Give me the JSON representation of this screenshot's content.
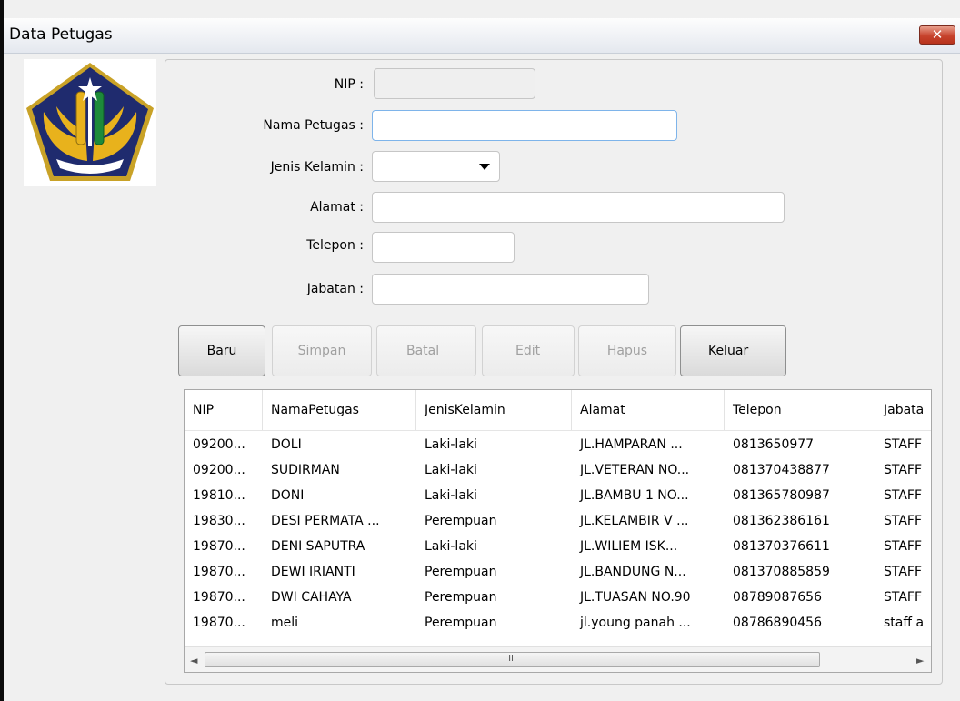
{
  "window": {
    "title": "Data Petugas",
    "close_glyph": "✕"
  },
  "form": {
    "nip_label": "NIP :",
    "nama_label": "Nama Petugas :",
    "jenis_label": "Jenis Kelamin :",
    "alamat_label": "Alamat :",
    "telepon_label": "Telepon :",
    "jabatan_label": "Jabatan :",
    "nip_value": "",
    "nama_value": "",
    "jenis_value": "",
    "alamat_value": "",
    "telepon_value": "",
    "jabatan_value": ""
  },
  "buttons": {
    "baru": "Baru",
    "simpan": "Simpan",
    "batal": "Batal",
    "edit": "Edit",
    "hapus": "Hapus",
    "keluar": "Keluar"
  },
  "table": {
    "columns": [
      "NIP",
      "NamaPetugas",
      "JenisKelamin",
      "Alamat",
      "Telepon",
      "Jabata"
    ],
    "rows": [
      [
        "09200...",
        "DOLI",
        "Laki-laki",
        "JL.HAMPARAN ...",
        "0813650977",
        "STAFF"
      ],
      [
        "09200...",
        "SUDIRMAN",
        "Laki-laki",
        "JL.VETERAN NO...",
        "081370438877",
        "STAFF"
      ],
      [
        "19810...",
        "DONI",
        "Laki-laki",
        "JL.BAMBU 1 NO...",
        "081365780987",
        "STAFF"
      ],
      [
        "19830...",
        "DESI PERMATA ...",
        "Perempuan",
        "JL.KELAMBIR V ...",
        "081362386161",
        "STAFF"
      ],
      [
        "19870...",
        "DENI SAPUTRA",
        "Laki-laki",
        "JL.WILIEM ISK...",
        "081370376611",
        "STAFF"
      ],
      [
        "19870...",
        "DEWI IRIANTI",
        "Perempuan",
        "JL.BANDUNG N...",
        "081370885859",
        "STAFF"
      ],
      [
        "19870...",
        "DWI CAHAYA",
        "Perempuan",
        "JL.TUASAN NO.90",
        "08789087656",
        "STAFF"
      ],
      [
        "19870...",
        "meli",
        "Perempuan",
        "jl.young panah ...",
        "08786890456",
        "staff a"
      ]
    ],
    "scroll_left_glyph": "◄",
    "scroll_right_glyph": "►",
    "scroll_grip_glyph": "III"
  },
  "colors": {
    "emblem_blue": "#1f2b6e",
    "emblem_gold": "#e8b21c",
    "emblem_green": "#1d8a3a"
  }
}
